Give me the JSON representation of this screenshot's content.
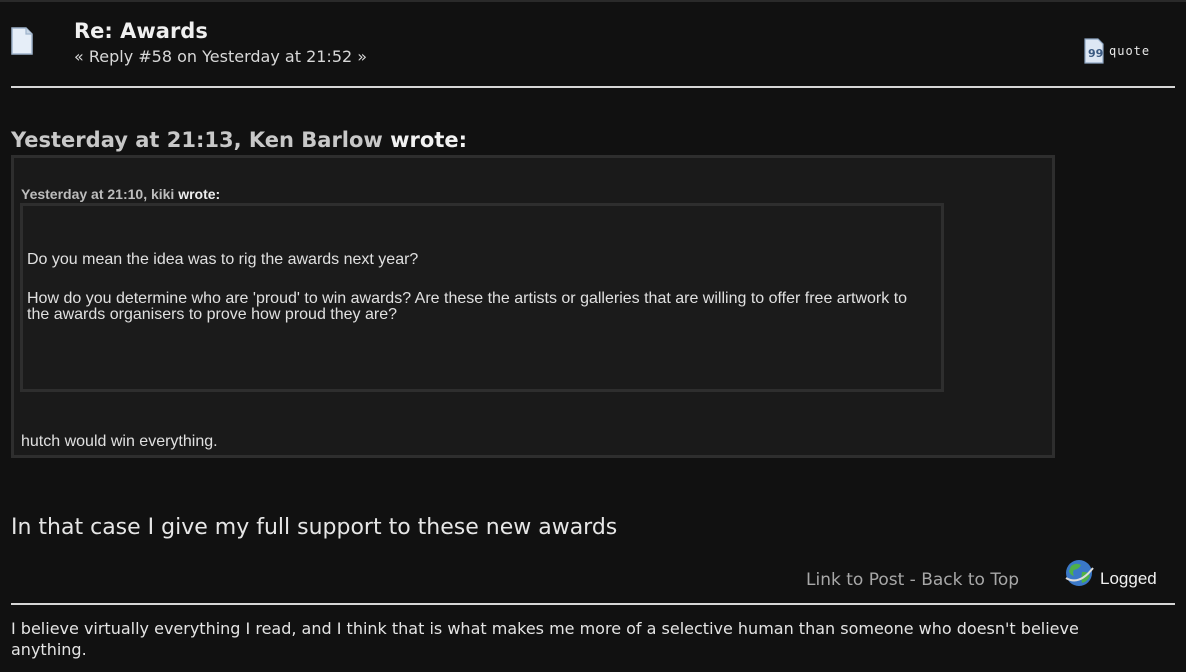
{
  "post": {
    "subject": "Re: Awards",
    "reply_info": "« Reply #58 on Yesterday at 21:52 »",
    "quote_label": "quote",
    "icons": {
      "post": "post-document-icon",
      "quote": "quote-icon",
      "logged": "globe-icon"
    }
  },
  "quote": {
    "author_line": "Yesterday at 21:13, Ken Barlow",
    "wrote": "wrote:",
    "nested": {
      "author_line": "Yesterday at 21:10, kiki",
      "wrote": "wrote:",
      "para1": "Do you mean the idea was to rig the awards next year?",
      "para2": "How do you determine who are 'proud' to win awards? Are these the artists or galleries that are willing to offer free artwork to the awards organisers to prove how proud they are?"
    },
    "text": "hutch would win everything."
  },
  "body": "In that case I give my full support to these new awards",
  "footer": {
    "link_to_post": "Link to Post",
    "sep": " - ",
    "back_to_top": "Back to Top",
    "logged": "Logged"
  },
  "signature": "I believe virtually everything I read, and I think that is what makes me more of a selective human than someone who doesn't believe anything."
}
